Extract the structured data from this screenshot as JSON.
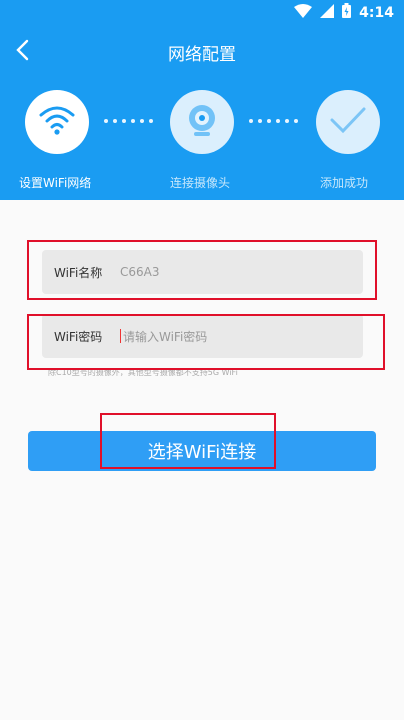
{
  "status_bar": {
    "time": "4:14"
  },
  "header": {
    "title": "网络配置"
  },
  "steps": [
    {
      "label": "设置WiFi网络",
      "icon": "wifi-icon",
      "active": true
    },
    {
      "label": "连接摄像头",
      "icon": "camera-icon",
      "active": false
    },
    {
      "label": "添加成功",
      "icon": "checkmark-icon",
      "active": false
    }
  ],
  "form": {
    "wifi_name_label": "WiFi名称",
    "wifi_name_value": "C66A3",
    "wifi_password_label": "WiFi密码",
    "wifi_password_placeholder": "请输入WiFi密码",
    "note": "除C10型号的摄像外，其他型号摄像都不支持5G WiFi"
  },
  "buttons": {
    "choose_wifi": "选择WiFi连接"
  },
  "colors": {
    "header_bg": "#1a9cf2",
    "button_bg": "#2f9ef5",
    "highlight_box": "#e0102a"
  }
}
